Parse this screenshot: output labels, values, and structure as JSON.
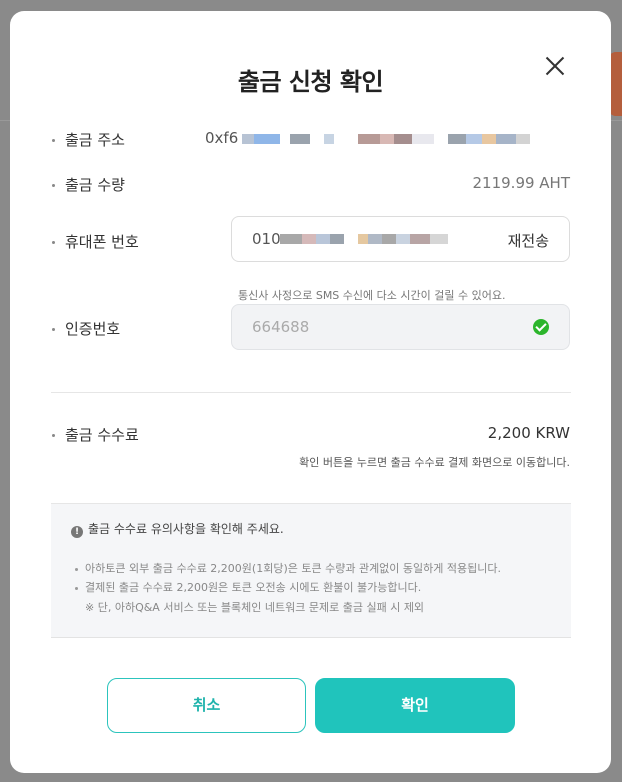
{
  "modal": {
    "title": "출금 신청 확인",
    "close_icon": "close-icon"
  },
  "rows": {
    "address_label": "출금 주소",
    "address_prefix": "0xf6",
    "amount_label": "출금 수량",
    "amount_value": "2119.99 AHT",
    "phone_label": "휴대폰 번호",
    "phone_prefix": "010",
    "resend_label": "재전송",
    "sms_hint": "통신사 사정으로 SMS 수신에 다소 시간이 걸릴 수 있어요.",
    "code_label": "인증번호",
    "code_value": "664688",
    "fee_label": "출금 수수료",
    "fee_value": "2,200 KRW",
    "fee_hint": "확인 버튼을 누르면 출금 수수료 결제 화면으로 이동합니다."
  },
  "notice": {
    "title": "출금 수수료 유의사항을 확인해 주세요.",
    "items": [
      "아하토큰 외부 출금 수수료 2,200원(1회당)은 토큰 수량과 관계없이 동일하게 적용됩니다.",
      "결제된 출금 수수료 2,200원은 토큰 오전송 시에도 환불이 불가능합니다."
    ],
    "sub": "※ 단, 아하Q&A 서비스 또는 블록체인 네트워크 문제로 출금 실패 시 제외"
  },
  "buttons": {
    "cancel_label": "취소",
    "confirm_label": "확인"
  },
  "colors": {
    "accent": "#20c4bc",
    "success": "#2cb52c"
  }
}
